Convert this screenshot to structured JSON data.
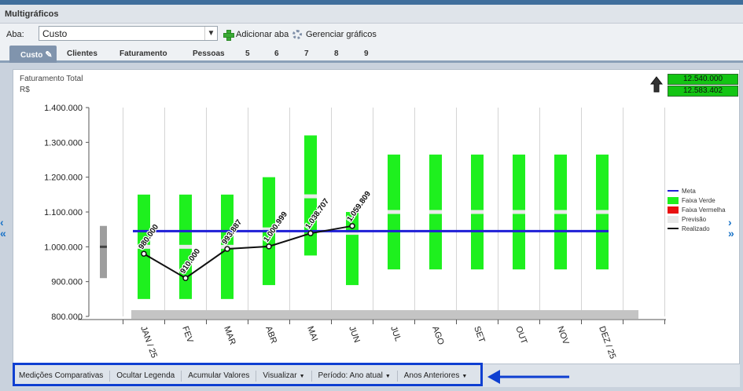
{
  "window": {
    "title": "Multigráficos"
  },
  "toolbar": {
    "aba_label": "Aba:",
    "aba_value": "Custo",
    "add_tab": "Adicionar aba",
    "manage_charts": "Gerenciar gráficos"
  },
  "tabs": [
    {
      "label": "Custo",
      "active": true
    },
    {
      "label": "Clientes"
    },
    {
      "label": "Faturamento"
    },
    {
      "label": "Pessoas"
    },
    {
      "label": "5"
    },
    {
      "label": "6"
    },
    {
      "label": "7"
    },
    {
      "label": "8"
    },
    {
      "label": "9"
    }
  ],
  "chart": {
    "title": "Faturamento Total",
    "unit": "R$",
    "totals": [
      "12.540.000",
      "12.583.402"
    ]
  },
  "chart_data": {
    "type": "line",
    "categories": [
      "JAN / 25",
      "FEV",
      "MAR",
      "ABR",
      "MAI",
      "JUN",
      "JUL",
      "AGO",
      "SET",
      "OUT",
      "NOV",
      "DEZ / 25"
    ],
    "ylim": [
      800000,
      1400000
    ],
    "yticks": [
      "1.400.000",
      "1.300.000",
      "1.200.000",
      "1.100.000",
      "1.000.000",
      "900.000",
      "800.000"
    ],
    "ytick_values": [
      1400000,
      1300000,
      1200000,
      1100000,
      1000000,
      900000,
      800000
    ],
    "green_band": [
      [
        850000,
        1150000
      ],
      [
        850000,
        1150000
      ],
      [
        850000,
        1150000
      ],
      [
        890000,
        1200000
      ],
      [
        975000,
        1320000
      ],
      [
        890000,
        1100000
      ],
      [
        935000,
        1265000
      ],
      [
        935000,
        1265000
      ],
      [
        935000,
        1265000
      ],
      [
        935000,
        1265000
      ],
      [
        935000,
        1265000
      ],
      [
        935000,
        1265000
      ]
    ],
    "forecast": [
      1000000,
      1000000,
      1000000,
      1050000,
      1145000,
      1040000,
      1100000,
      1100000,
      1100000,
      1100000,
      1100000,
      1100000
    ],
    "meta": 1045000,
    "previous": {
      "range": [
        910000,
        1060000
      ],
      "mid": 1000000
    },
    "realizado": [
      980000,
      910000,
      993887,
      1000999,
      1038707,
      1059809
    ],
    "realizado_labels": [
      "980.000",
      "910.000",
      "993.887",
      "1.000.999",
      "1.038.707",
      "1.059.809"
    ],
    "legend": [
      {
        "label": "Meta",
        "color": "#1f1fd6",
        "kind": "line"
      },
      {
        "label": "Faixa Verde",
        "color": "#1ef01e",
        "kind": "box"
      },
      {
        "label": "Faixa Vermelha",
        "color": "#e81010",
        "kind": "box"
      },
      {
        "label": "Previsão",
        "color": "#e8e8e8",
        "kind": "box"
      },
      {
        "label": "Realizado",
        "color": "#111111",
        "kind": "line"
      }
    ]
  },
  "navigation": {
    "left": "‹«",
    "right": "›»"
  },
  "bottom_bar": [
    {
      "label": "Medições Comparativas",
      "dropdown": false
    },
    {
      "label": "Ocultar Legenda",
      "dropdown": false
    },
    {
      "label": "Acumular Valores",
      "dropdown": false
    },
    {
      "label": "Visualizar",
      "dropdown": true
    },
    {
      "label": "Período: Ano atual",
      "dropdown": true
    },
    {
      "label": "Anos Anteriores",
      "dropdown": true
    }
  ],
  "icons": {
    "add": "plus-icon",
    "manage": "gear-icon",
    "edit": "pencil-icon",
    "trend": "arrow-up-icon"
  }
}
